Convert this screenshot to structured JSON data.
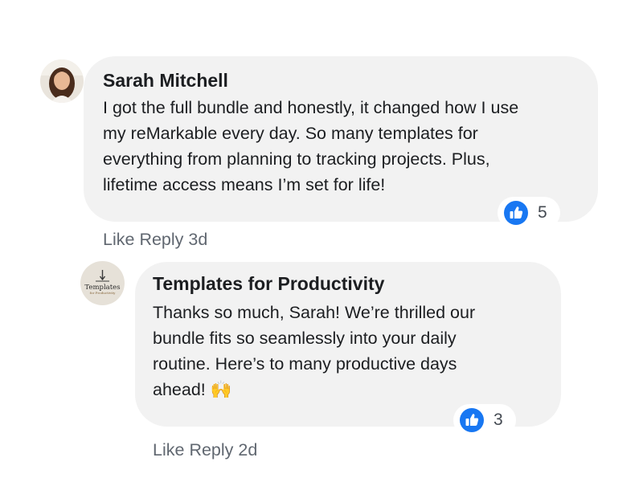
{
  "comment": {
    "author": "Sarah Mitchell",
    "text": "I got the full bundle and honestly, it changed how I use\nmy reMarkable every day. So many templates for\neverything from planning to tracking projects. Plus,\nlifetime access means I’m set for life!",
    "reaction_count": "5",
    "actions": {
      "like": "Like",
      "reply": "Reply",
      "time": "3d"
    }
  },
  "reply": {
    "author": "Templates for Productivity",
    "text": "Thanks so much, Sarah! We’re thrilled our\nbundle fits so seamlessly into your daily\nroutine. Here’s to many productive days\nahead! 🙌",
    "reaction_count": "3",
    "logo_text": "Templates",
    "logo_subtext": "for Productivity",
    "actions": {
      "like": "Like",
      "reply": "Reply",
      "time": "2d"
    }
  },
  "icons": {
    "reaction": "like-thumbs-up-icon"
  },
  "colors": {
    "bubble": "#f2f2f2",
    "like_blue": "#1877f2",
    "meta_text": "#606770"
  }
}
